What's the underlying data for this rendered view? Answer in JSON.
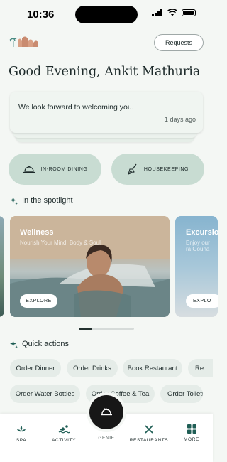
{
  "status_bar": {
    "time": "10:36"
  },
  "header": {
    "requests_label": "Requests"
  },
  "greeting": "Good Evening, Ankit Mathuria",
  "message": {
    "text": "We look forward to welcoming you.",
    "time": "1 days ago"
  },
  "services": [
    {
      "label": "IN-ROOM DINING",
      "icon": "cloche-icon"
    },
    {
      "label": "HOUSEKEEPING",
      "icon": "broom-icon"
    }
  ],
  "spotlight": {
    "title": "In the spotlight",
    "cards": [
      {
        "title": "Wellness",
        "subtitle": "Nourish Your Mind, Body & Soul",
        "button": "EXPLORE"
      },
      {
        "title": "Excursio",
        "subtitle": "Enjoy our ra Gouna",
        "button": "EXPLO"
      }
    ]
  },
  "quick_actions": {
    "title": "Quick actions",
    "row1": [
      "Order Dinner",
      "Order Drinks",
      "Book Restaurant",
      "Re"
    ],
    "row2": [
      "Order Water Bottles",
      "Order Coffee & Tea",
      "Order Toiletr"
    ]
  },
  "bottom_nav": {
    "items": [
      {
        "label": "SPA",
        "icon": "lotus-icon"
      },
      {
        "label": "ACTIVITY",
        "icon": "swimmer-icon"
      },
      {
        "label": "RESTAURANTS",
        "icon": "utensils-icon"
      },
      {
        "label": "MORE",
        "icon": "grid-icon"
      }
    ],
    "center": {
      "label": "GENIE",
      "icon": "service-bell-icon"
    }
  }
}
